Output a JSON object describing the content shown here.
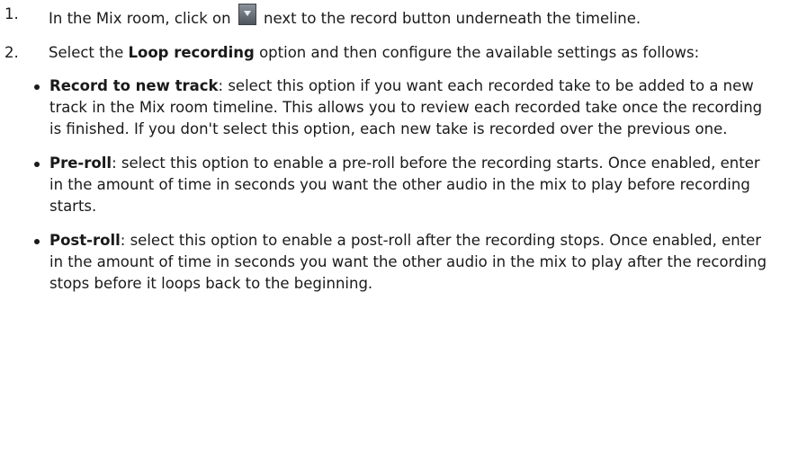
{
  "steps": [
    {
      "number": "1.",
      "text_before": "In the Mix room, click on ",
      "icon": "dropdown-arrow-icon",
      "text_after": " next to the record button underneath the timeline."
    },
    {
      "number": "2.",
      "text_before": "Select the ",
      "bold": "Loop recording",
      "text_after": " option and then configure the available settings as follows:"
    }
  ],
  "options": [
    {
      "term": "Record to new track",
      "description": ": select this option if you want each recorded take to be added to a new track in the Mix room timeline. This allows you to review each recorded take once the recording is finished. If you don't select this option, each new take is recorded over the previous one."
    },
    {
      "term": "Pre-roll",
      "description": ": select this option to enable a pre-roll before the recording starts. Once enabled, enter in the amount of time in seconds you want the other audio in the mix to play before recording starts."
    },
    {
      "term": "Post-roll",
      "description": ": select this option to enable a post-roll after the recording stops. Once enabled, enter in the amount of time in seconds you want the other audio in the mix to play after the recording stops before it loops back to the beginning."
    }
  ],
  "colors": {
    "text": "#1a1a1a",
    "icon_fill": "#5f666d"
  }
}
